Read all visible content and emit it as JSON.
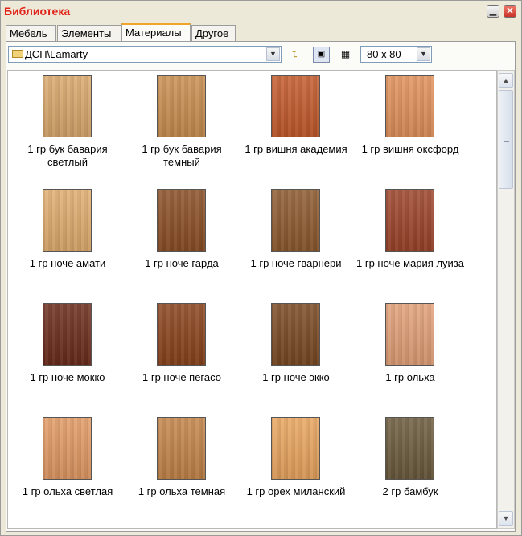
{
  "window": {
    "title": "Библиотека"
  },
  "tabs": [
    "Мебель",
    "Элементы",
    "Материалы",
    "Другое"
  ],
  "active_tab": "Материалы",
  "toolbar": {
    "path": "ДСП\\Lamarty",
    "size": "80 x  80"
  },
  "icons": {
    "folder": "folder-icon",
    "dropdown": "chevron-down-icon",
    "up_folder": "folder-up-icon",
    "view_thumbnails": "thumbnail-view-icon",
    "view_details": "detail-view-icon",
    "scroll_up": "arrow-up-icon",
    "scroll_down": "arrow-down-icon"
  },
  "materials": [
    {
      "label": "1 гр бук бавария светлый",
      "color": "#d9a86c"
    },
    {
      "label": "1 гр бук бавария темный",
      "color": "#c98e4f"
    },
    {
      "label": "1 гр вишня академия",
      "color": "#c35a2b"
    },
    {
      "label": "1 гр вишня оксфорд",
      "color": "#e1915b"
    },
    {
      "label": "1 гр ноче амати",
      "color": "#e1ad6f"
    },
    {
      "label": "1 гр ноче гарда",
      "color": "#8b4f25"
    },
    {
      "label": "1 гр ноче гварнери",
      "color": "#8d5a2e"
    },
    {
      "label": "1 гр ноче мария луиза",
      "color": "#9c442a"
    },
    {
      "label": "1 гр ноче мокко",
      "color": "#6b2c1c"
    },
    {
      "label": "1 гр ноче пегасо",
      "color": "#8a431c"
    },
    {
      "label": "1 гр ноче экко",
      "color": "#7a4a23"
    },
    {
      "label": "1 гр ольха",
      "color": "#e2a077"
    },
    {
      "label": "1 гр ольха светлая",
      "color": "#e19a64"
    },
    {
      "label": "1 гр ольха темная",
      "color": "#c38449"
    },
    {
      "label": "1 гр орех миланский",
      "color": "#e9a55f"
    },
    {
      "label": "2 гр бамбук",
      "color": "#6b5b3d"
    }
  ]
}
